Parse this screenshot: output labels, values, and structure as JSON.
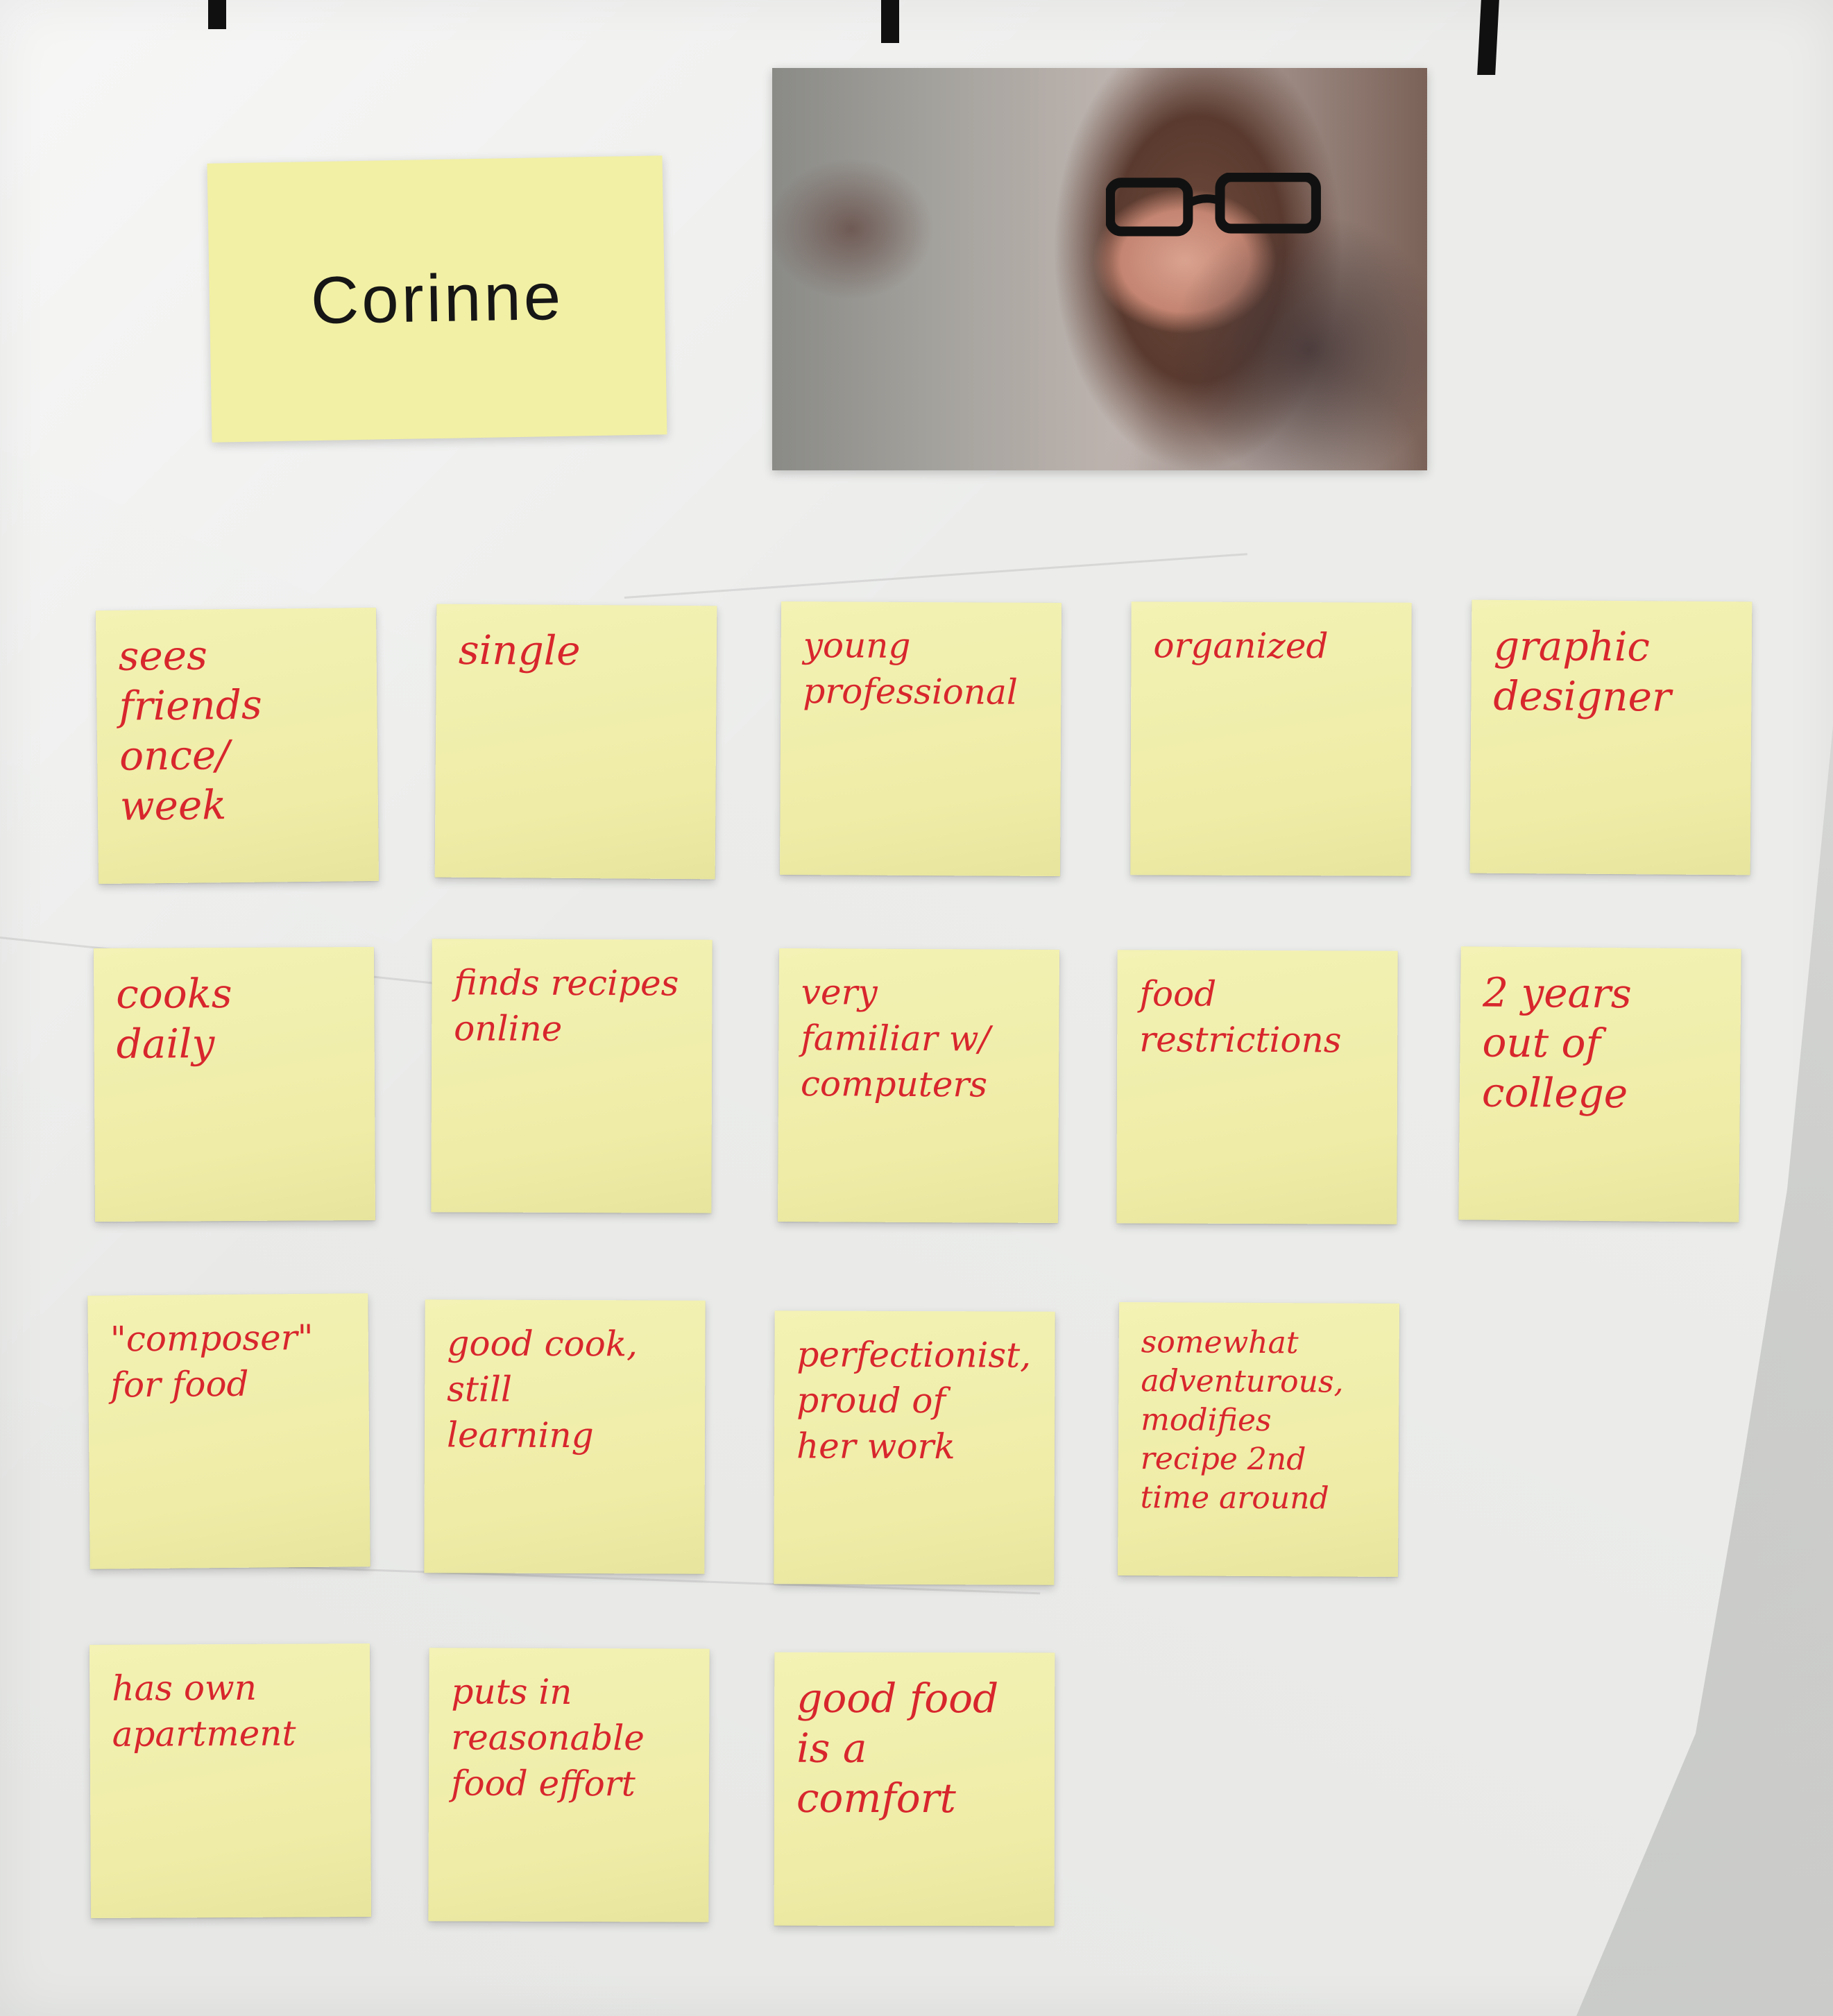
{
  "persona": {
    "name": "Corinne"
  },
  "photo": {
    "alt": "portrait photo"
  },
  "notes": [
    "sees\nfriends\nonce/\nweek",
    "single",
    "young\nprofessional",
    "organized",
    "graphic\ndesigner",
    "cooks\ndaily",
    "finds recipes\nonline",
    "very\nfamiliar w/\ncomputers",
    "food\nrestrictions",
    "2 years\nout of\ncollege",
    "\"composer\"\nfor food",
    "good cook,\nstill\nlearning",
    "perfectionist,\nproud of\nher work",
    "somewhat\nadventurous,\nmodifies\nrecipe 2nd\ntime around",
    "has own\napartment",
    "puts in\nreasonable\nfood effort",
    "good food\nis a\ncomfort"
  ],
  "colors": {
    "note_yellow": "#f2f0aa",
    "marker_red": "#d8262d",
    "name_ink": "#161616"
  }
}
